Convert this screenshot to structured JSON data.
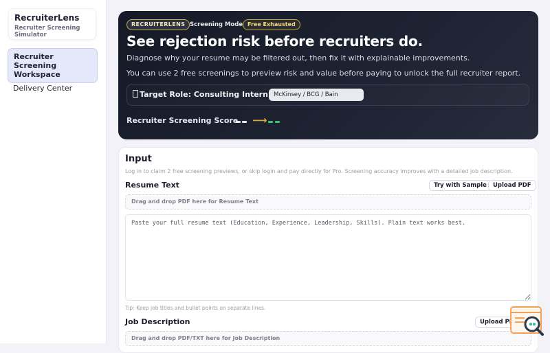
{
  "sidebar": {
    "brand_name": "RecruiterLens",
    "brand_sub": "Recruiter Screening Simulator",
    "items": [
      {
        "label": "Recruiter Screening Workspace",
        "active": true
      },
      {
        "label": "Delivery Center",
        "active": false
      }
    ]
  },
  "hero": {
    "badge": "RECRUITERLENS",
    "mode": "Screening Mode",
    "free_badge": "Free Exhausted",
    "title": "See rejection risk before recruiters do.",
    "desc": "Diagnose why your resume may be filtered out, then fix it with explainable improvements.",
    "desc2": "You can use 2 free screenings to preview risk and value before paying to unlock the full recruiter report.",
    "target_icon": "target-icon",
    "target_label": "Target Role: Consulting Intern @",
    "target_value": "McKinsey / BCG / Bain",
    "score_label": "Recruiter Screening Score",
    "colors": {
      "from": "#e6e8ee",
      "arrow": "#e0a23a",
      "to": "#3cc46a"
    }
  },
  "input": {
    "title": "Input",
    "note": "Log in to claim 2 free screening previews, or skip login and pay directly for Pro. Screening accuracy improves with a detailed job description.",
    "resume_label": "Resume Text",
    "try_sample": "Try with Sample",
    "upload_pdf": "Upload PDF",
    "resume_drop": "Drag and drop PDF here for Resume Text",
    "resume_placeholder": "Paste your full resume text (Education, Experience, Leadership, Skills). Plain text works best.",
    "tip": "Tip: Keep job titles and bullet points on separate lines.",
    "jd_label": "Job Description",
    "upload_pdf_txt": "Upload PDF/TXT",
    "jd_drop": "Drag and drop PDF/TXT here for Job Description"
  }
}
